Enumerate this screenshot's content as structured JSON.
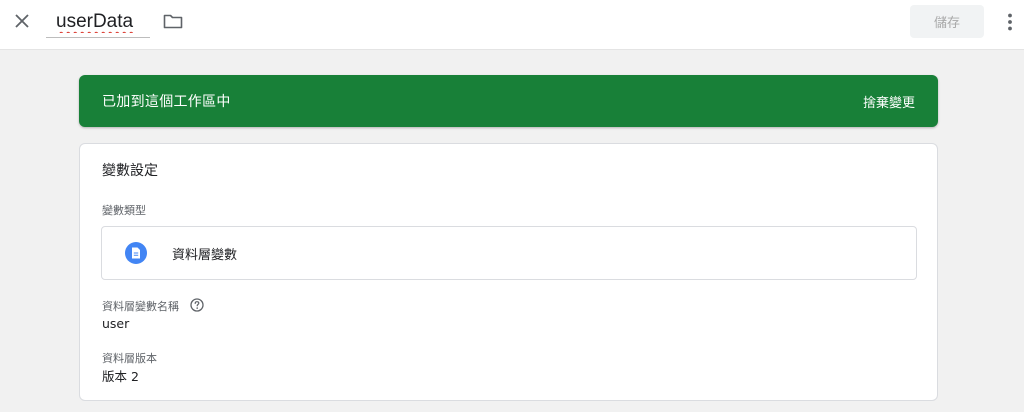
{
  "header": {
    "close_icon": "close-icon",
    "variable_name": "userData",
    "folder_icon": "folder-icon",
    "save_label": "儲存",
    "more_icon": "more-vert-icon"
  },
  "banner": {
    "message": "已加到這個工作區中",
    "action_label": "捨棄變更",
    "color": "#188038"
  },
  "config": {
    "title": "變數設定",
    "type_section_label": "變數類型",
    "variable_type": {
      "icon": "document-icon",
      "label": "資料層變數"
    },
    "name_field": {
      "label": "資料層變數名稱",
      "help_icon": "help-icon",
      "value": "user"
    },
    "version_field": {
      "label": "資料層版本",
      "value": "版本 2"
    }
  },
  "colors": {
    "accent_blue": "#4285f4",
    "banner_green": "#188038",
    "background": "#f1f1f1"
  }
}
